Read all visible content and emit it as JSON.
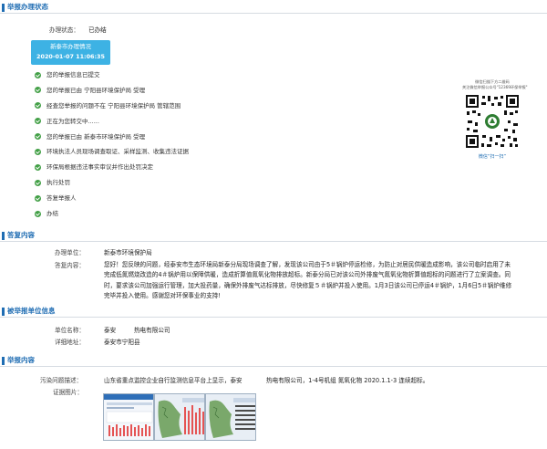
{
  "section_status": {
    "title": "举报办理状态"
  },
  "status": {
    "label": "办理状态：",
    "value": "已办结"
  },
  "status_box": {
    "line1": "新泰市办理情况",
    "line2": "2020-01-07 11:06:35"
  },
  "steps": [
    "您的举报信息已提交",
    "您的举报已由 宁阳县环境保护局 受理",
    "经查您举报的问题不在 宁阳县环境保护局 管辖范围",
    "正在为您转交中......",
    "您的举报已由 新泰市环境保护局 受理",
    "环境执法人员现场调查取证、采样监测、收集违法证据",
    "环保局根据违法事实审议并作出处罚决定",
    "执行处罚",
    "答复举报人",
    "办结"
  ],
  "qr": {
    "caption1": "微信扫描下方二维码",
    "caption2": "关注微信举报公众号\"12369环保举报\"",
    "footer": "微信“扫一扫”"
  },
  "section_reply": {
    "title": "答复内容"
  },
  "reply": {
    "unit_label": "办理单位：",
    "unit_value": "新泰市环境保护局",
    "content_label": "答复内容：",
    "content_value": "您好！您反映的问题，经泰安市生态环境局新泰分局现场调查了解，发现该公司由于5＃锅炉停运检修，为防止对居民供暖造成影响，该公司临时启用了未完成低氮燃烧改造的4＃锅炉用以保障供暖，造成折算值氮氧化物排放超标。新泰分局已对该公司外排废气氮氧化物折算值超标的问题进行了立案调查。同时，要求该公司加强运行管理，加大投药量，确保外排废气达标排放，尽快修复５＃锅炉并投入使用。1月3日该公司已停运4＃锅炉，1月6日5＃锅炉维修完毕并投入使用。感谢您对环保事业的支持!"
  },
  "section_unit": {
    "title": "被举报单位信息"
  },
  "unit": {
    "name_label": "单位名称：",
    "name_value": "泰安　　　热电有限公司",
    "addr_label": "详细地址：",
    "addr_value": "泰安市宁阳县"
  },
  "section_report": {
    "title": "举报内容"
  },
  "report": {
    "desc_label": "污染问题描述：",
    "desc_value": "山东省重点监控企业自行监测信息平台上显示，泰安　　　　热电有限公司，1-4号机组 氮氧化物 2020.1.1-3 连续超标。",
    "photo_label": "证据图片："
  },
  "colors": {
    "accent": "#1f6db3",
    "status_box": "#3db2e4",
    "check": "#43a047"
  }
}
